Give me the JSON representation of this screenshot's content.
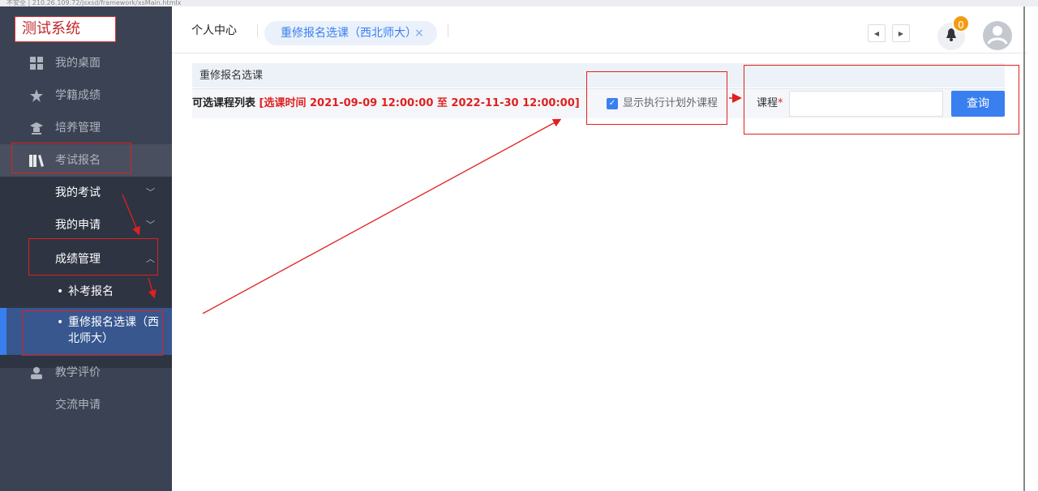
{
  "browser": {
    "url": "不安全 | 210.26.109.72/jsxsd/framework/xsMain.htmlx"
  },
  "app": {
    "title": "测试系统"
  },
  "sidebar": {
    "items": [
      {
        "label": "我的桌面",
        "icon": "windows-icon"
      },
      {
        "label": "学籍成绩",
        "icon": "star-icon"
      },
      {
        "label": "培养管理",
        "icon": "graduation-cap-icon"
      },
      {
        "label": "考试报名",
        "icon": "books-icon"
      },
      {
        "label": "教学评价",
        "icon": "user-icon"
      },
      {
        "label": "交流申请",
        "icon": ""
      }
    ],
    "submenu": {
      "my_exams": "我的考试",
      "my_applications": "我的申请",
      "grade_management": "成绩管理",
      "makeup_exam": "补考报名",
      "retake_course": "重修报名选课（西北师大）",
      "retake_course_line1": "重修报名选课（西",
      "retake_course_line2": "北师大）"
    }
  },
  "header": {
    "breadcrumb": "个人中心",
    "active_tab": "重修报名选课（西北师大）",
    "tab_close": "×",
    "prev_icon": "◀",
    "next_icon": "▶",
    "notification_count": "0"
  },
  "panel": {
    "title": "重修报名选课",
    "list_label": "可选课程列表",
    "time_range": "[选课时间 2021-09-09 12:00:00 至 2022-11-30 12:00:00]",
    "checkbox_label": "显示执行计划外课程",
    "checkbox_checked": true,
    "course_label": "课程",
    "required_mark": "*",
    "course_input_value": "",
    "query_button": "查询"
  },
  "colors": {
    "sidebar_bg": "#3b4253",
    "accent_blue": "#3a7ff0",
    "annotation_red": "#e02020",
    "badge_orange": "#f39c12"
  }
}
